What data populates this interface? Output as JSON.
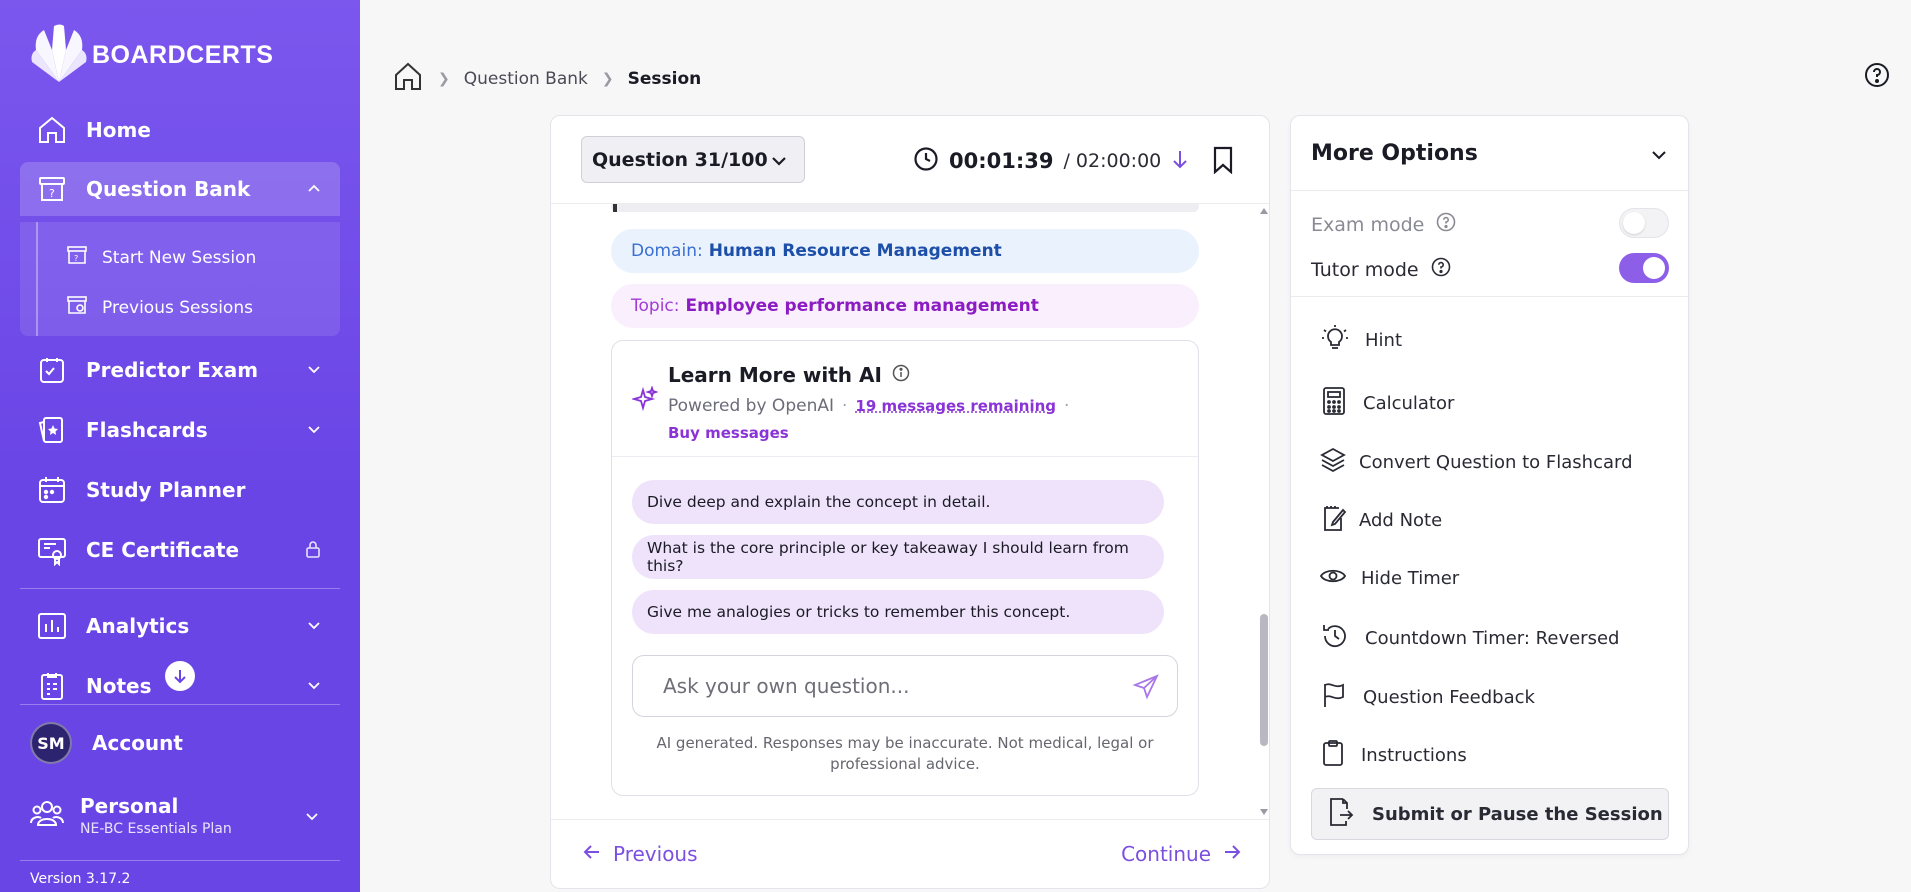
{
  "brand": {
    "name": "BOARDCERTS"
  },
  "sidebar": {
    "items": [
      {
        "label": "Home",
        "icon": "home-icon"
      },
      {
        "label": "Question Bank",
        "icon": "question-bank-icon"
      },
      {
        "label": "Predictor Exam",
        "icon": "predictor-exam-icon"
      },
      {
        "label": "Flashcards",
        "icon": "flashcards-icon"
      },
      {
        "label": "Study Planner",
        "icon": "calendar-icon"
      },
      {
        "label": "CE Certificate",
        "icon": "certificate-icon"
      },
      {
        "label": "Analytics",
        "icon": "analytics-icon"
      },
      {
        "label": "Notes",
        "icon": "notes-icon"
      }
    ],
    "subitems": [
      {
        "label": "Start New Session"
      },
      {
        "label": "Previous Sessions"
      }
    ],
    "account": {
      "initials": "SM",
      "label": "Account"
    },
    "personal": {
      "title": "Personal",
      "plan": "NE-BC Essentials Plan"
    },
    "version": "Version 3.17.2"
  },
  "breadcrumb": {
    "items": [
      "Question Bank",
      "Session"
    ]
  },
  "question": {
    "selector": "Question 31/100",
    "timer_elapsed": "00:01:39",
    "timer_total": "/ 02:00:00",
    "domain_label": "Domain:",
    "domain_value": "Human Resource Management",
    "topic_label": "Topic:",
    "topic_value": "Employee performance management"
  },
  "ai": {
    "title": "Learn More with AI",
    "powered_by": "Powered by OpenAI",
    "remaining": "19 messages remaining",
    "buy": "Buy messages",
    "suggestions": [
      "Dive deep and explain the concept in detail.",
      "What is the core principle or key takeaway I should learn from this?",
      "Give me analogies or tricks to remember this concept."
    ],
    "input_placeholder": "Ask your own question...",
    "disclaimer": "AI generated. Responses may be inaccurate. Not medical, legal or professional advice."
  },
  "footer": {
    "previous": "Previous",
    "continue": "Continue"
  },
  "options": {
    "title": "More Options",
    "exam_mode": {
      "label": "Exam mode",
      "enabled": false
    },
    "tutor_mode": {
      "label": "Tutor mode",
      "enabled": true
    },
    "items": [
      {
        "label": "Hint",
        "icon": "lightbulb-icon"
      },
      {
        "label": "Calculator",
        "icon": "calculator-icon"
      },
      {
        "label": "Convert Question to Flashcard",
        "icon": "layers-icon"
      },
      {
        "label": "Add Note",
        "icon": "edit-note-icon"
      },
      {
        "label": "Hide Timer",
        "icon": "eye-icon"
      },
      {
        "label": "Countdown Timer: Reversed",
        "icon": "history-icon"
      },
      {
        "label": "Question Feedback",
        "icon": "flag-icon"
      },
      {
        "label": "Instructions",
        "icon": "clipboard-icon"
      }
    ],
    "submit": "Submit or Pause the Session"
  },
  "colors": {
    "sidebar": "#6a45e6",
    "accent": "#7b4fe0",
    "domain": "#1d4fa8",
    "topic": "#8b1cc3"
  }
}
